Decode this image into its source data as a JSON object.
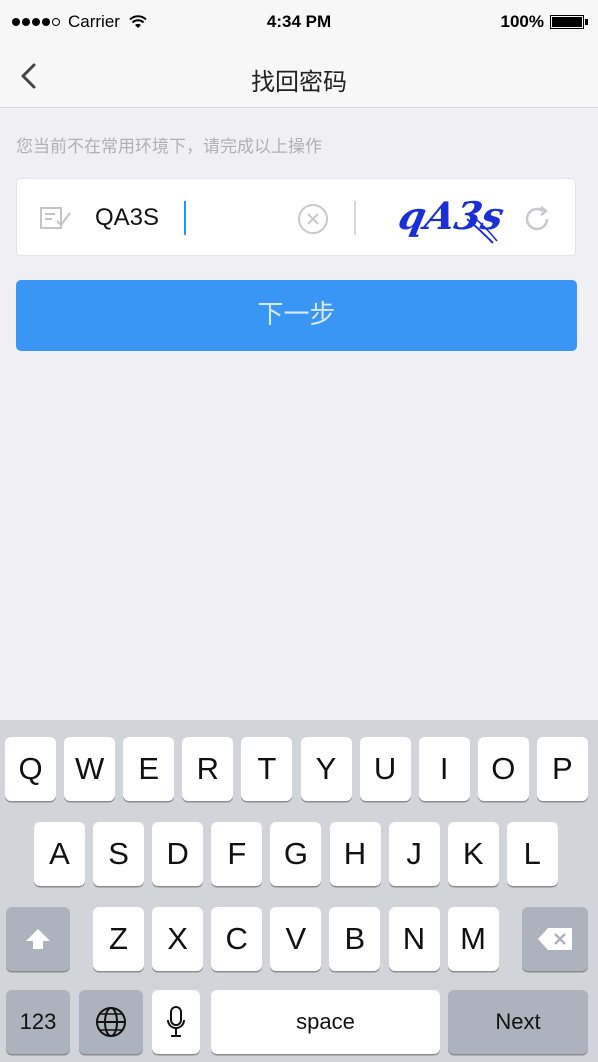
{
  "status_bar": {
    "carrier": "Carrier",
    "time": "4:34 PM",
    "battery": "100%",
    "signal_icon": "signal-dots-icon",
    "wifi_icon": "wifi-icon",
    "battery_icon": "battery-icon",
    "battery_level": 1.0
  },
  "nav": {
    "title": "找回密码",
    "back_icon": "chevron-left-icon"
  },
  "hint": "您当前不在常用环境下，请完成以上操作",
  "captcha": {
    "value": "QA3S",
    "placeholder": "",
    "image_text": "qA3s",
    "edit_icon": "edit-icon",
    "clear_icon": "clear-circle-icon",
    "refresh_icon": "refresh-icon"
  },
  "next_button": "下一步",
  "keyboard": {
    "row1": [
      "Q",
      "W",
      "E",
      "R",
      "T",
      "Y",
      "U",
      "I",
      "O",
      "P"
    ],
    "row2": [
      "A",
      "S",
      "D",
      "F",
      "G",
      "H",
      "J",
      "K",
      "L"
    ],
    "row3": [
      "Z",
      "X",
      "C",
      "V",
      "B",
      "N",
      "M"
    ],
    "numbers_label": "123",
    "space_label": "space",
    "next_label": "Next",
    "shift_icon": "shift-icon",
    "delete_icon": "backspace-icon",
    "globe_icon": "globe-icon",
    "mic_icon": "microphone-icon"
  },
  "colors": {
    "accent": "#3a96f4",
    "background": "#efeff4",
    "keyboard_bg": "#d1d4d9",
    "captcha_ink": "#1a2fd8"
  }
}
